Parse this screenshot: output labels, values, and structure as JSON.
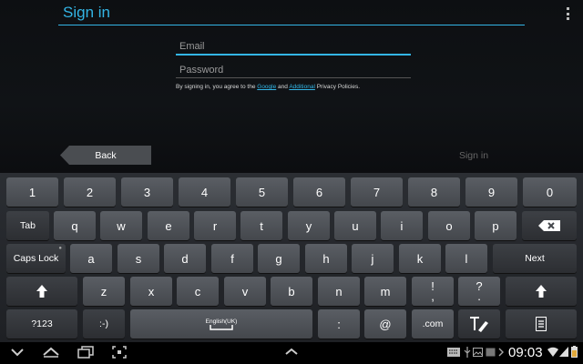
{
  "header": {
    "title": "Sign in"
  },
  "form": {
    "email_placeholder": "Email",
    "password_placeholder": "Password",
    "privacy_prefix": "By signing in, you agree to the ",
    "privacy_google": "Google",
    "privacy_and": " and ",
    "privacy_additional": "Additional",
    "privacy_suffix": " Privacy Policies."
  },
  "actions": {
    "back_label": "Back",
    "signin_label": "Sign in"
  },
  "keyboard": {
    "row1": [
      "1",
      "2",
      "3",
      "4",
      "5",
      "6",
      "7",
      "8",
      "9",
      "0"
    ],
    "row2": [
      "q",
      "w",
      "e",
      "r",
      "t",
      "y",
      "u",
      "i",
      "o",
      "p"
    ],
    "row3": [
      "a",
      "s",
      "d",
      "f",
      "g",
      "h",
      "j",
      "k",
      "l"
    ],
    "row4": [
      "z",
      "x",
      "c",
      "v",
      "b",
      "n",
      "m"
    ],
    "tab": "Tab",
    "caps": "Caps Lock",
    "next": "Next",
    "sym": "?123",
    "emoticon": ":-)",
    "space_label": "English(UK)",
    "colon": ":",
    "at": "@",
    "dotcom": ".com",
    "exclaim": "!",
    "comma": ",",
    "question": "?",
    "period": "."
  },
  "statusbar": {
    "time": "09:03"
  }
}
